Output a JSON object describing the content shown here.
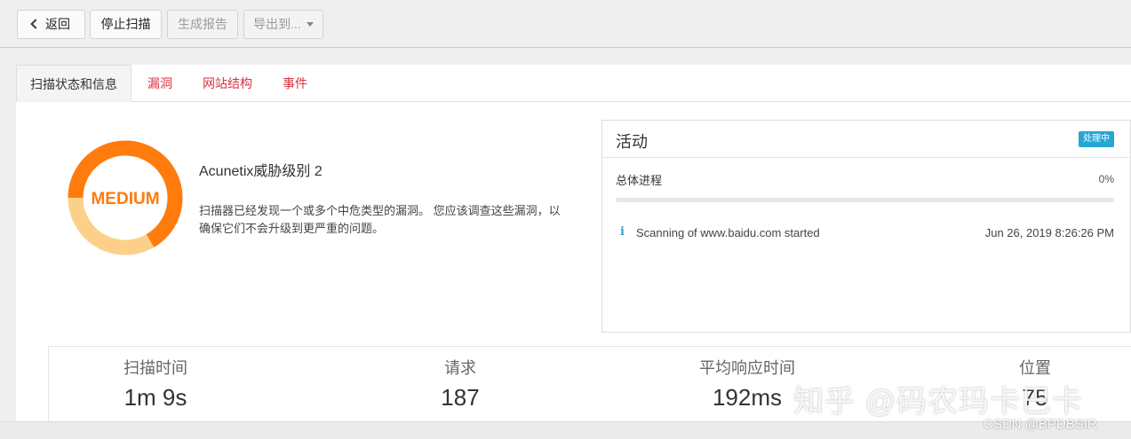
{
  "toolbar": {
    "back_label": "返回",
    "stop_label": "停止扫描",
    "report_label": "生成报告",
    "export_label": "导出到..."
  },
  "tabs": [
    {
      "label": "扫描状态和信息",
      "active": true
    },
    {
      "label": "漏洞",
      "active": false
    },
    {
      "label": "网站结构",
      "active": false
    },
    {
      "label": "事件",
      "active": false
    }
  ],
  "threat": {
    "level_text": "MEDIUM",
    "title": "Acunetix威胁级别 2",
    "description": "扫描器已经发现一个或多个中危类型的漏洞。 您应该调查这些漏洞，以确保它们不会升级到更严重的问题。",
    "level": 2,
    "max_level": 3,
    "colors": {
      "filled": "#ff7b0c",
      "empty": "#fdd08a",
      "text": "#ff7b0c"
    }
  },
  "activity": {
    "title": "活动",
    "badge": "处理中",
    "progress_label": "总体进程",
    "progress_value": "0%",
    "progress_fraction": 0,
    "log": [
      {
        "icon": "info-icon",
        "message": "Scanning of www.baidu.com started",
        "time": "Jun 26, 2019 8:26:26 PM"
      }
    ]
  },
  "stats": [
    {
      "label": "扫描时间",
      "value": "1m 9s"
    },
    {
      "label": "请求",
      "value": "187"
    },
    {
      "label": "平均响应时间",
      "value": "192ms"
    },
    {
      "label": "位置",
      "value": "75"
    }
  ],
  "watermarks": {
    "zhihu": "知乎 @码农玛卡巴卡",
    "csdn": "CSDN @BPDBSIR"
  },
  "colors": {
    "accent": "#27a6d3",
    "tab_link": "#d9333f"
  }
}
